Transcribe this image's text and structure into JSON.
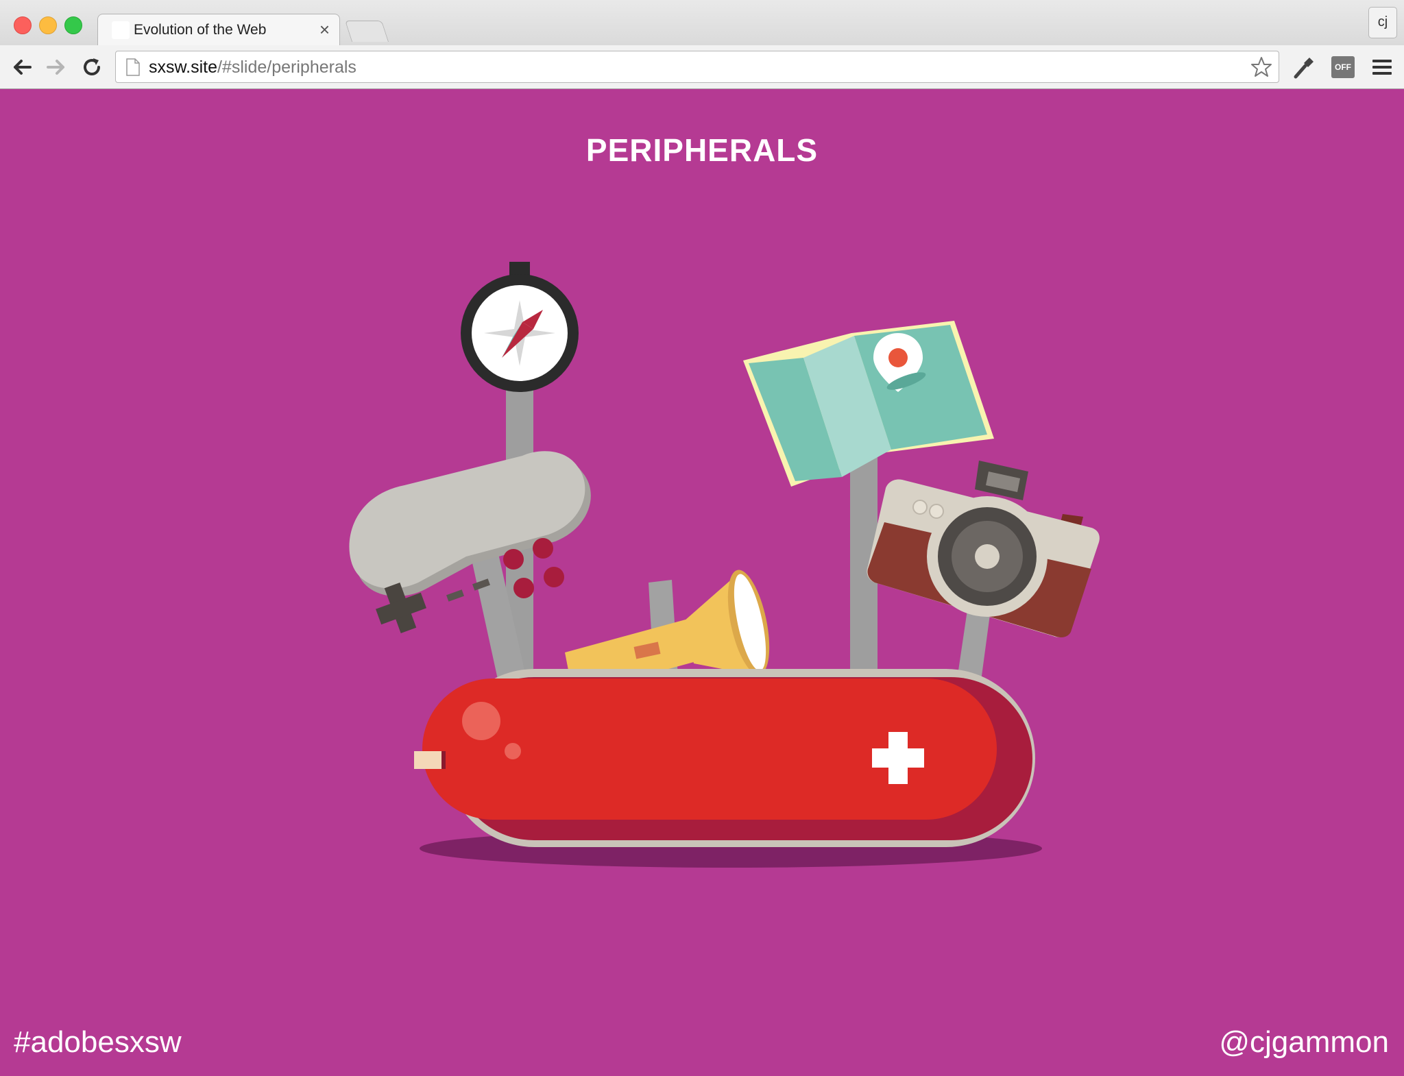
{
  "tab": {
    "title": "Evolution of the Web",
    "close_glyph": "×"
  },
  "profile": {
    "label": "cj"
  },
  "address": {
    "host": "sxsw.site",
    "path": "/#slide/peripherals"
  },
  "toolbar": {
    "off_label": "OFF"
  },
  "slide": {
    "title": "PERIPHERALS",
    "hashtag": "#adobesxsw",
    "handle": "@cjgammon",
    "illustration_items": [
      "compass-icon",
      "game-controller-icon",
      "flashlight-icon",
      "map-icon",
      "camera-icon",
      "swiss-army-knife-icon"
    ]
  },
  "colors": {
    "background": "#b53a93",
    "knife_red": "#dd2a26",
    "knife_shadow": "#a81d3d",
    "map_teal": "#7cc6b4",
    "flashlight_yellow": "#f2c35a",
    "camera_brown": "#8a3a30"
  }
}
